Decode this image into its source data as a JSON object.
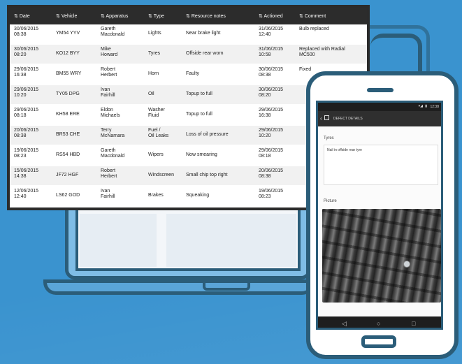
{
  "table": {
    "headers": [
      "Date",
      "Vehicle",
      "Apparatus",
      "Type",
      "Resource notes",
      "Actioned",
      "Comment"
    ],
    "rows": [
      {
        "date": "30/06/2015\n08:38",
        "vehicle": "YM54 YYV",
        "person": "Gareth\nMacdonald",
        "type": "Lights",
        "notes": "Near brake light",
        "actioned": "31/06/2015\n12:40",
        "comment": "Bulb replaced"
      },
      {
        "date": "30/06/2015\n08:20",
        "vehicle": "KO12 BYY",
        "person": "Mike\nHoward",
        "type": "Tyres",
        "notes": "Offside rear worn",
        "actioned": "31/06/2015\n10:58",
        "comment": "Replaced with Radial\nMC500"
      },
      {
        "date": "29/06/2015\n16:38",
        "vehicle": "BM55 WRY",
        "person": "Robert\nHerbert",
        "type": "Horn",
        "notes": "Faulty",
        "actioned": "30/06/2015\n08:38",
        "comment": "Fixed"
      },
      {
        "date": "29/06/2015\n10:20",
        "vehicle": "TY05 DPG",
        "person": "Ivan\nFairhill",
        "type": "Oil",
        "notes": "Topup to full",
        "actioned": "30/06/2015\n08:20",
        "comment": ""
      },
      {
        "date": "29/06/2015\n08:18",
        "vehicle": "KH58 ERE",
        "person": "Eldon\nMichaels",
        "type": "Washer\nFluid",
        "notes": "Topup to full",
        "actioned": "29/06/2015\n16:38",
        "comment": ""
      },
      {
        "date": "20/06/2015\n08:38",
        "vehicle": "BR53 CHE",
        "person": "Terry\nMcNamara",
        "type": "Fuel /\nOil Leaks",
        "notes": "Loss of oil pressure",
        "actioned": "29/06/2015\n10:20",
        "comment": ""
      },
      {
        "date": "19/06/2015\n08:23",
        "vehicle": "RS54 HBD",
        "person": "Gareth\nMacdonald",
        "type": "Wipers",
        "notes": "Now smearing",
        "actioned": "29/06/2015\n08:18",
        "comment": ""
      },
      {
        "date": "15/06/2015\n14:38",
        "vehicle": "JF72 HGF",
        "person": "Robert\nHerbert",
        "type": "Windscreen",
        "notes": "Small chip top right",
        "actioned": "20/06/2015\n08:38",
        "comment": ""
      },
      {
        "date": "12/06/2015\n12:40",
        "vehicle": "LS62 GOD",
        "person": "Ivan\nFairhill",
        "type": "Brakes",
        "notes": "Squeaking",
        "actioned": "19/06/2015\n08:23",
        "comment": ""
      }
    ]
  },
  "phone": {
    "status_time": "12:38",
    "appbar_title": "DEFECT DETAILS",
    "type_label": "Tyres",
    "type_value": "Nail in offside rear tyre",
    "picture_label": "Picture"
  },
  "colors": {
    "background": "#3a93cf",
    "outline": "#2b5d79",
    "table_header": "#2c2c2c"
  },
  "icons": [
    "back-arrow-icon",
    "calendar-icon",
    "signal-icon",
    "battery-icon",
    "nav-back-icon",
    "nav-home-icon",
    "nav-recent-icon"
  ]
}
